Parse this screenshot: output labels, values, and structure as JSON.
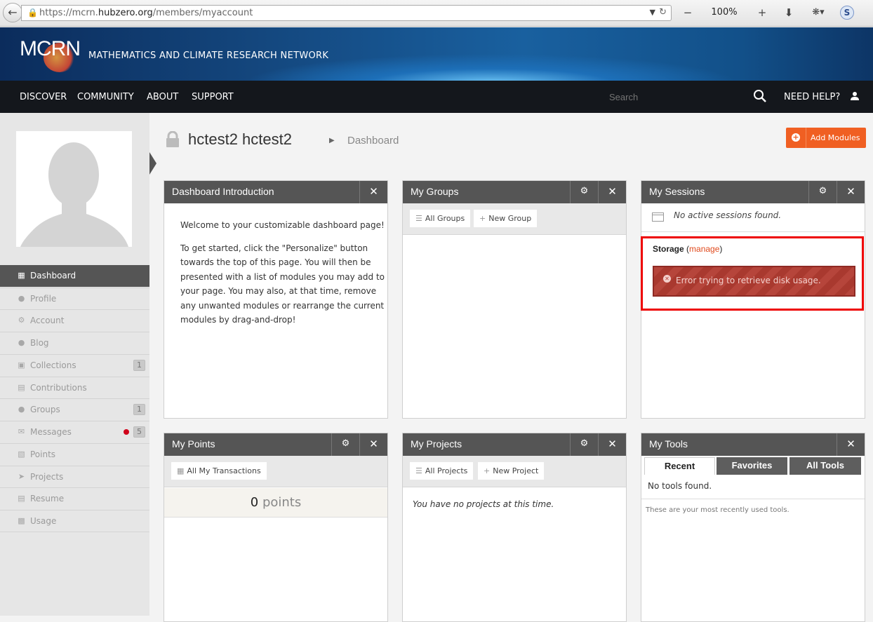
{
  "browser": {
    "url_prefix": "https://mcrn.",
    "url_domain": "hubzero.org",
    "url_path": "/members/myaccount",
    "zoom": "100%"
  },
  "site": {
    "logo_text": "MCRN",
    "name": "MATHEMATICS AND CLIMATE RESEARCH NETWORK"
  },
  "nav": {
    "items": [
      "DISCOVER",
      "COMMUNITY",
      "ABOUT",
      "SUPPORT"
    ],
    "search_placeholder": "Search",
    "help": "NEED HELP?"
  },
  "sidebar": {
    "items": [
      {
        "label": "Dashboard",
        "icon": "dashboard-icon",
        "active": true
      },
      {
        "label": "Profile",
        "icon": "user-icon"
      },
      {
        "label": "Account",
        "icon": "cogs-icon"
      },
      {
        "label": "Blog",
        "icon": "chat-bubble-icon"
      },
      {
        "label": "Collections",
        "icon": "box-icon",
        "count": "1"
      },
      {
        "label": "Contributions",
        "icon": "document-icon"
      },
      {
        "label": "Groups",
        "icon": "users-icon",
        "count": "1"
      },
      {
        "label": "Messages",
        "icon": "envelope-icon",
        "count": "5"
      },
      {
        "label": "Points",
        "icon": "points-icon"
      },
      {
        "label": "Projects",
        "icon": "paper-plane-icon"
      },
      {
        "label": "Resume",
        "icon": "file-icon"
      },
      {
        "label": "Usage",
        "icon": "bar-chart-icon"
      }
    ]
  },
  "header": {
    "member_name": "hctest2 hctest2",
    "crumb": "Dashboard",
    "add_modules": "Add Modules"
  },
  "modules": {
    "intro": {
      "title": "Dashboard Introduction",
      "p1": "Welcome to your customizable dashboard page!",
      "p2_l1": "To get started, click the \"Personalize\" button",
      "p2_l2": "towards the top of this page. You will then be",
      "p2_l3": "presented with a list of modules you may add to",
      "p2_l4": "your page. You may also, at that time, remove",
      "p2_l5": "any unwanted modules or rearrange the current",
      "p2_l6": "modules by drag-and-drop!"
    },
    "groups": {
      "title": "My Groups",
      "all": "All Groups",
      "new": "New Group"
    },
    "sessions": {
      "title": "My Sessions",
      "empty": "No active sessions found.",
      "storage_label": "Storage",
      "storage_link": "manage",
      "error": "Error trying to retrieve disk usage."
    },
    "points": {
      "title": "My Points",
      "transactions": "All My Transactions",
      "value": "0",
      "unit": "points"
    },
    "projects": {
      "title": "My Projects",
      "all": "All Projects",
      "new": "New Project",
      "empty": "You have no projects at this time."
    },
    "tools": {
      "title": "My Tools",
      "tabs": [
        "Recent",
        "Favorites",
        "All Tools"
      ],
      "empty": "No tools found.",
      "note": "These are your most recently used tools."
    }
  }
}
